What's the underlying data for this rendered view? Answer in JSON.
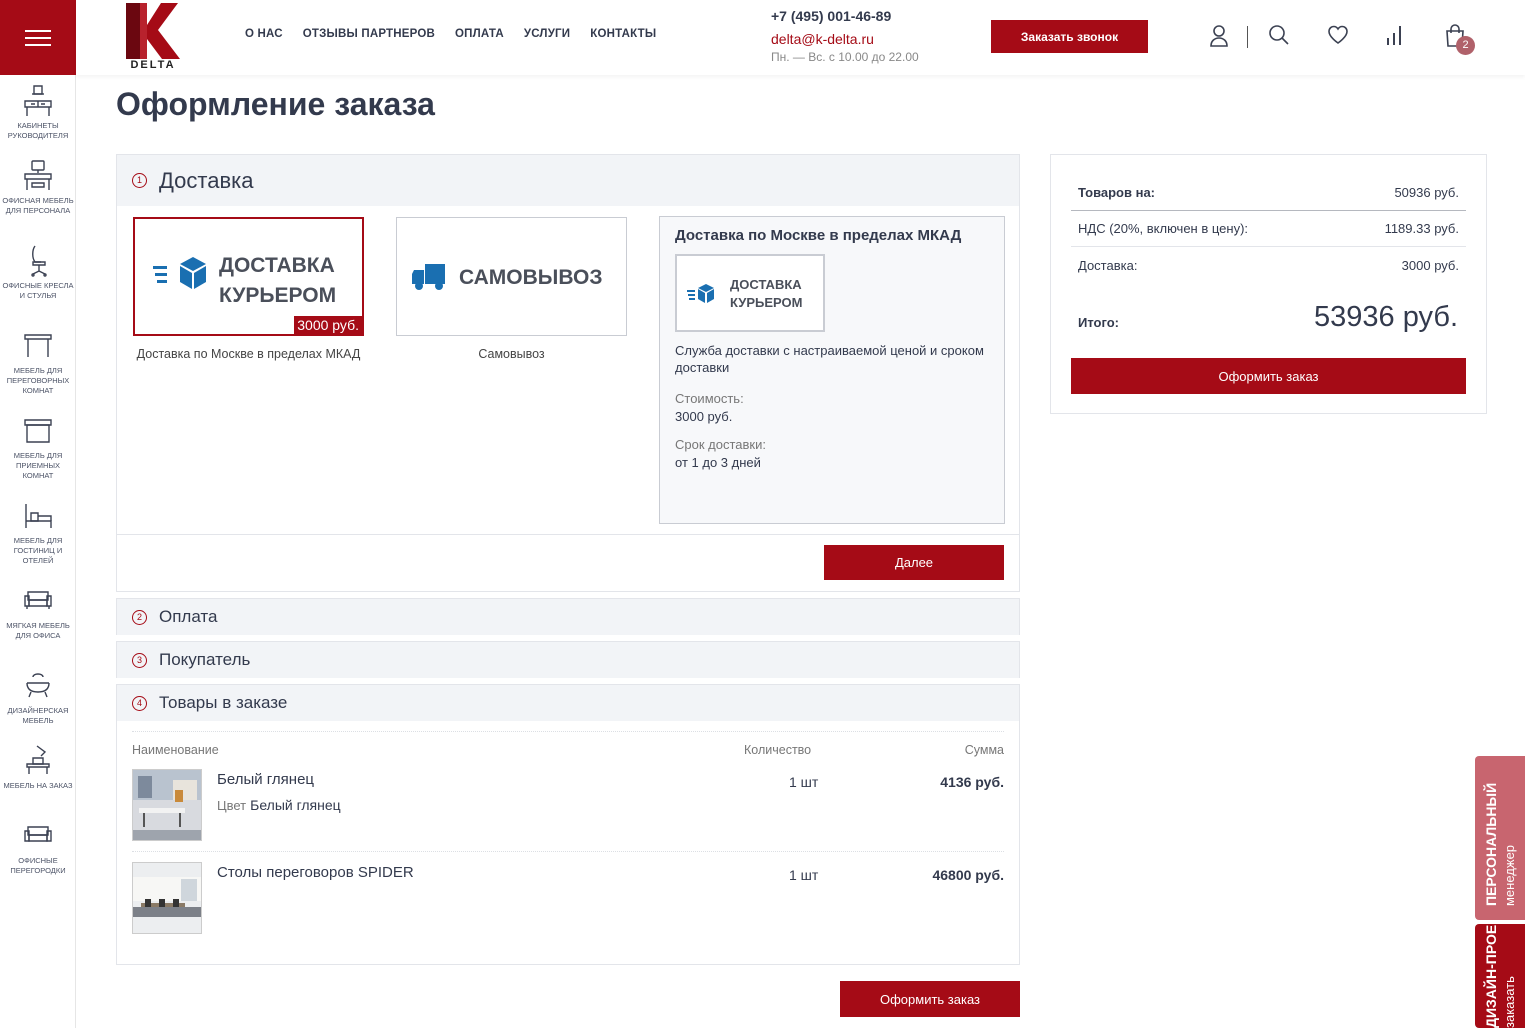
{
  "sidebar": {
    "items": [
      {
        "label": "КАБИНЕТЫ РУКОВОДИТЕЛЯ"
      },
      {
        "label": "ОФИСНАЯ МЕБЕЛЬ ДЛЯ ПЕРСОНАЛА"
      },
      {
        "label": "ОФИСНЫЕ КРЕСЛА И СТУЛЬЯ"
      },
      {
        "label": "МЕБЕЛЬ ДЛЯ ПЕРЕГОВОРНЫХ КОМНАТ"
      },
      {
        "label": "МЕБЕЛЬ ДЛЯ ПРИЕМНЫХ КОМНАТ"
      },
      {
        "label": "МЕБЕЛЬ ДЛЯ ГОСТИНИЦ И ОТЕЛЕЙ"
      },
      {
        "label": "МЯГКАЯ МЕБЕЛЬ ДЛЯ ОФИСА"
      },
      {
        "label": "ДИЗАЙНЕРСКАЯ МЕБЕЛЬ"
      },
      {
        "label": "МЕБЕЛЬ НА ЗАКАЗ"
      },
      {
        "label": "ОФИСНЫЕ ПЕРЕГОРОДКИ"
      }
    ]
  },
  "header": {
    "logo_text": "DELTA",
    "nav": [
      "О НАС",
      "ОТЗЫВЫ ПАРТНЕРОВ",
      "ОПЛАТА",
      "УСЛУГИ",
      "КОНТАКТЫ"
    ],
    "phone": "+7 (495) 001-46-89",
    "email": "delta@k-delta.ru",
    "hours": "Пн. — Вс. с 10.00 до 22.00",
    "call_button": "Заказать звонок",
    "cart_count": "2",
    "icons": [
      "user-icon",
      "search-icon",
      "heart-icon",
      "compare-icon",
      "cart-icon"
    ]
  },
  "page": {
    "title": "Оформление заказа"
  },
  "delivery": {
    "num": "1",
    "title": "Доставка",
    "options": [
      {
        "logo_line1": "ДОСТАВКА",
        "logo_line2": "КУРЬЕРОМ",
        "price_badge": "3000 руб.",
        "caption": "Доставка по Москве в пределах МКАД"
      },
      {
        "logo_line1": "САМОВЫВОЗ",
        "caption": "Самовывоз"
      }
    ],
    "info": {
      "title": "Доставка по Москве в пределах МКАД",
      "logo_line1": "ДОСТАВКА",
      "logo_line2": "КУРЬЕРОМ",
      "description": "Служба доставки с настраиваемой ценой и сроком доставки",
      "cost_label": "Стоимость:",
      "cost_value": "3000 руб.",
      "term_label": "Срок доставки:",
      "term_value": "от 1 до 3 дней"
    },
    "next_button": "Далее"
  },
  "payment": {
    "num": "2",
    "title": "Оплата"
  },
  "buyer": {
    "num": "3",
    "title": "Покупатель"
  },
  "goods": {
    "num": "4",
    "title": "Товары в заказе",
    "columns": [
      "Наименование",
      "Количество",
      "Сумма"
    ],
    "items": [
      {
        "name": "Белый глянец",
        "prop_label": "Цвет",
        "prop_value": "Белый глянец",
        "qty": "1 шт",
        "sum": "4136 руб."
      },
      {
        "name": "Столы переговоров SPIDER",
        "qty": "1 шт",
        "sum": "46800 руб."
      }
    ]
  },
  "summary": {
    "rows": [
      {
        "label": "Товаров на:",
        "value": "50936 руб."
      },
      {
        "label": "НДС (20%, включен в цену):",
        "value": "1189.33 руб."
      },
      {
        "label": "Доставка:",
        "value": "3000 руб."
      }
    ],
    "total_label": "Итого:",
    "total_value": "53936 руб.",
    "button": "Оформить заказ"
  },
  "bottom_button": "Оформить заказ",
  "floating": {
    "manager_bold": "ПЕРСОНАЛЬНЫЙ",
    "manager_light": "менеджер",
    "design_bold": "ДИЗАЙН-ПРОЕКТ",
    "design_light": "заказать"
  },
  "colors": {
    "accent": "#a50b16",
    "text": "#333a4d",
    "icon_blue": "#1a6fb1"
  }
}
